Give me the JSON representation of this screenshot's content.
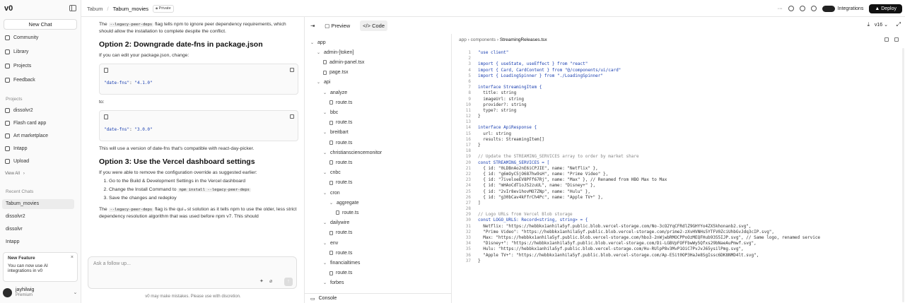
{
  "app": {
    "logo": "v0"
  },
  "sidebar": {
    "new_chat": "New Chat",
    "nav": [
      "Community",
      "Library",
      "Projects",
      "Feedback"
    ],
    "projects_label": "Projects",
    "projects": [
      "dissolvr2",
      "Flash card app",
      "Art marketplace",
      "Intapp",
      "Upload"
    ],
    "view_all": "View All",
    "recent_label": "Recent Chats",
    "recent": [
      "Tabum_movies",
      "dissolvr2",
      "dissolvr",
      "Intapp"
    ],
    "feature": {
      "title": "New Feature",
      "text": "You can now use AI integrations in v0",
      "close": "×"
    },
    "user": {
      "name": "jayhilwig",
      "plan": "Premium"
    }
  },
  "header": {
    "crumb1": "Tabum",
    "crumb2": "Tabum_movies",
    "badge": "Private",
    "integrations": "Integrations",
    "deploy": "Deploy"
  },
  "chat": {
    "p1a": "The",
    "p1code": "--legacy-peer-deps",
    "p1b": "flag tells npm to ignore peer dependency requirements, which should allow the installation to complete despite the conflict.",
    "h2": "Option 2: Downgrade date-fns in package.json",
    "p2": "If you can edit your package.json, change:",
    "code1": "\"4.1.0\"",
    "to": "to:",
    "code2": "\"3.0.0\"",
    "p3": "This will use a version of date-fns that's compatible with react-day-picker.",
    "h3": "Option 3: Use the Vercel dashboard settings",
    "p4": "If you were able to remove the configuration override as suggested earlier:",
    "steps": [
      "Go to the Build & Development Settings in the Vercel dashboard",
      "Change the Install Command to",
      "Save the changes and redeploy"
    ],
    "step2code": "npm install --legacy-peer-deps",
    "p5a": "The",
    "p5code": "--legacy-peer-deps",
    "p5b": "flag is the qui",
    "p5c": "st solution as it tells npm to use the older, less strict dependency resolution algorithm that was used before npm v7. This should",
    "input_placeholder": "Ask a follow up...",
    "disclaimer": "v0 may make mistakes. Please use with discretion."
  },
  "preview": {
    "tab_preview": "Preview",
    "tab_code": "Code",
    "version": "v16",
    "console": "Console",
    "filepath": {
      "a": "app",
      "b": "components",
      "c": "StreamingReleases.tsx"
    }
  },
  "tree": [
    {
      "label": "app",
      "d": 0,
      "t": "folder"
    },
    {
      "label": "admin-[token]",
      "d": 1,
      "t": "folder"
    },
    {
      "label": "admin-panel.tsx",
      "d": 2,
      "t": "file"
    },
    {
      "label": "page.tsx",
      "d": 2,
      "t": "file"
    },
    {
      "label": "api",
      "d": 1,
      "t": "folder"
    },
    {
      "label": "analyze",
      "d": 2,
      "t": "folder"
    },
    {
      "label": "route.ts",
      "d": 3,
      "t": "file"
    },
    {
      "label": "bbc",
      "d": 2,
      "t": "folder"
    },
    {
      "label": "route.ts",
      "d": 3,
      "t": "file"
    },
    {
      "label": "breitbart",
      "d": 2,
      "t": "folder"
    },
    {
      "label": "route.ts",
      "d": 3,
      "t": "file"
    },
    {
      "label": "christiansciencemonitor",
      "d": 2,
      "t": "folder"
    },
    {
      "label": "route.ts",
      "d": 3,
      "t": "file"
    },
    {
      "label": "cnbc",
      "d": 2,
      "t": "folder"
    },
    {
      "label": "route.ts",
      "d": 3,
      "t": "file"
    },
    {
      "label": "cron",
      "d": 2,
      "t": "folder"
    },
    {
      "label": "aggregate",
      "d": 3,
      "t": "folder"
    },
    {
      "label": "route.ts",
      "d": 4,
      "t": "file"
    },
    {
      "label": "dailywire",
      "d": 2,
      "t": "folder"
    },
    {
      "label": "route.ts",
      "d": 3,
      "t": "file"
    },
    {
      "label": "env",
      "d": 2,
      "t": "folder"
    },
    {
      "label": "route.ts",
      "d": 3,
      "t": "file"
    },
    {
      "label": "financialtimes",
      "d": 2,
      "t": "folder"
    },
    {
      "label": "route.ts",
      "d": 3,
      "t": "file"
    },
    {
      "label": "forbes",
      "d": 2,
      "t": "folder"
    }
  ],
  "code": {
    "start_line": 1,
    "lines": [
      "\"use client\"",
      "",
      "import { useState, useEffect } from \"react\"",
      "import { Card, CardContent } from \"@/components/ui/card\"",
      "import { LoadingSpinner } from \"./LoadingSpinner\"",
      "",
      "interface StreamingItem {",
      "  title: string",
      "  imageUrl: string",
      "  provider?: string",
      "  type?: string",
      "}",
      "",
      "interface ApiResponse {",
      "  url: string",
      "  results: StreamingItem[]",
      "}",
      "",
      "// Update the STREAMING_SERVICES array to order by market share",
      "const STREAMING_SERVICES = [",
      "  { id: \"0LDBnAo2nE6iCPJIE\", name: \"Netflix\" },",
      "  { id: \"g6mOyC5jO687hw9sH\", name: \"Prime Video\" },",
      "  { id: \"7iveloeEV8PFf67Rj\", name: \"Max\" }, // Renamed from HBO Max to Max",
      "  { id: \"mHAoCdT1oJS2zuUL\", name: \"Disney+\" },",
      "  { id: \"2vIr8ev1hovMO7ZNp\", name: \"Hulu\" },",
      "  { id: \"g30bCav4kFfrCh4Pc\", name: \"Apple TV+\" },",
      "]",
      "",
      "// Logo URLs from Vercel Blob storage",
      "const LOGO_URLS: Record<string, string> = {",
      "  Netflix: \"https://hebbkx1anhila5yf.public.blob.vercel-storage.com/No-3cO2YqCFRdlZ9GHYYo4ZX5khonanb2.svg\",",
      "  \"Prime Video\": \"https://hebbkx1anhila5yf.public.blob.vercel-storage.com/prime2-zXvHVNHs5YTFV0ZciUhbGvJdq3cIP.svg\",",
      "  Max: \"https://hebbkx1anhila5yf.public.blob.vercel-storage.com/hbo3-2nWjwbRMOCPPoOzMEQFHub9355IJP.svg\", // Same logo, renamed service",
      "  \"Disney+\": \"https://hebbkx1anhila5yf.public.blob.vercel-storage.com/Di-LGBVpFOFFbwWy5Qfxs29bNaeAuPmwf.svg\",",
      "  Hulu: \"https://hebbkx1anhila5yf.public.blob.vercel-storage.com/Hu-RUlpP8v3MvP1OiC7PvJvJ65ysilPmg.svg\",",
      "  \"Apple TV+\": \"https://hebbkx1anhila5yf.public.blob.vercel-storage.com/Ap-E5it0OP3HaJe8SgIssc6DK8NMD4lt.svg\",",
      "}"
    ]
  }
}
